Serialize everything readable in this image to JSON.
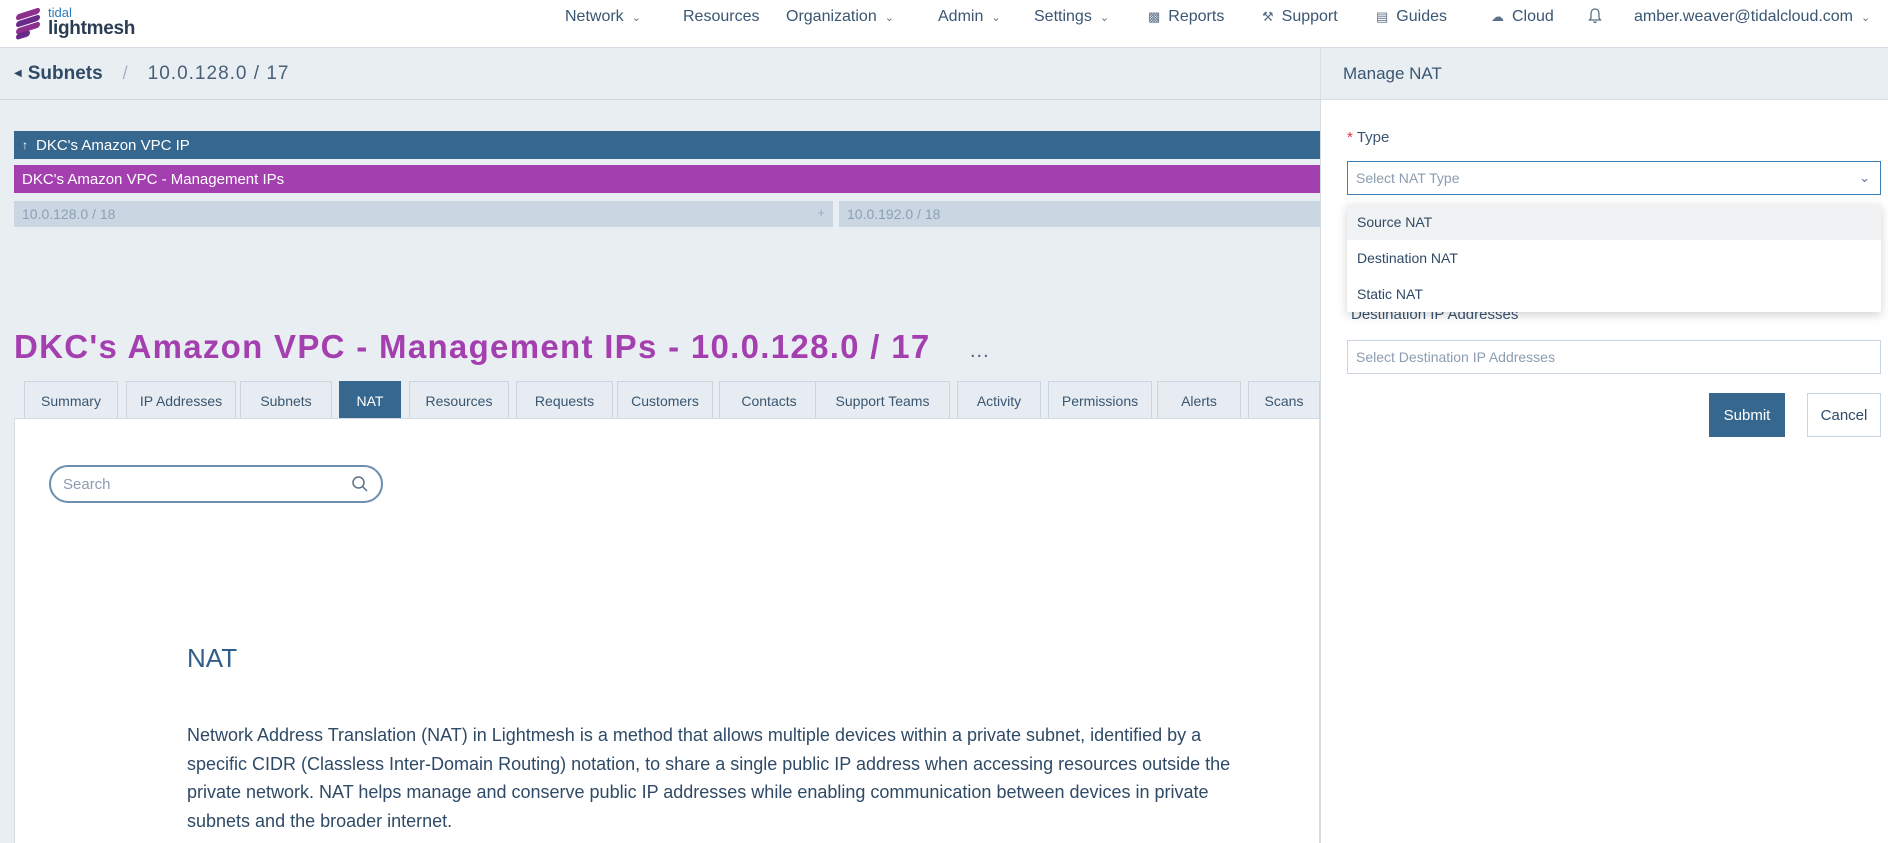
{
  "brand": {
    "small": "tidal",
    "big": "lightmesh"
  },
  "nav": {
    "network": "Network",
    "resources": "Resources",
    "organization": "Organization",
    "admin": "Admin",
    "settings": "Settings",
    "reports": "Reports",
    "support": "Support",
    "guides": "Guides",
    "cloud": "Cloud",
    "user": "amber.weaver@tidalcloud.com"
  },
  "breadcrumb": {
    "parent": "Subnets",
    "separator": "/",
    "current": "10.0.128.0 / 17"
  },
  "hierarchy": {
    "parent": "DKC's Amazon VPC IP",
    "current": "DKC's Amazon VPC - Management IPs",
    "children": [
      "10.0.128.0 / 18",
      "10.0.192.0 / 18"
    ],
    "child_add": "+"
  },
  "page": {
    "title": "DKC's Amazon VPC - Management IPs - 10.0.128.0 / 17",
    "more": "..."
  },
  "tabs": [
    "Summary",
    "IP Addresses",
    "Subnets",
    "NAT",
    "Resources",
    "Requests",
    "Customers",
    "Contacts",
    "Support Teams",
    "Activity",
    "Permissions",
    "Alerts",
    "Scans"
  ],
  "active_tab": "NAT",
  "search": {
    "placeholder": "Search"
  },
  "content": {
    "heading": "NAT",
    "description": "Network Address Translation (NAT) in Lightmesh is a method that allows multiple devices within a private subnet, identified by a specific CIDR (Classless Inter-Domain Routing) notation, to share a single public IP address when accessing resources outside the private network. NAT helps manage and conserve public IP addresses while enabling communication between devices in private subnets and the broader internet."
  },
  "drawer": {
    "title": "Manage NAT",
    "type_required": "*",
    "type_label": "Type",
    "type_placeholder": "Select NAT Type",
    "options": [
      "Source NAT",
      "Destination NAT",
      "Static NAT"
    ],
    "dest_label_partial": "Destination IP Addresses",
    "dest_placeholder": "Select Destination IP Addresses",
    "submit": "Submit",
    "cancel": "Cancel"
  },
  "colors": {
    "primary": "#36678f",
    "accent": "#a43fb0",
    "required": "#e0383e"
  }
}
